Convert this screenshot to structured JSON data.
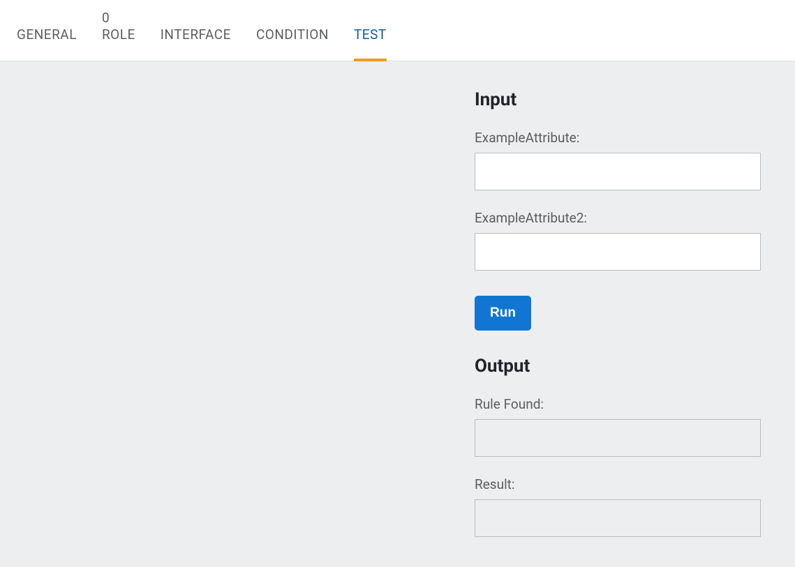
{
  "tabs": {
    "general": "GENERAL",
    "role_badge": "0",
    "role": "ROLE",
    "interface": "INTERFACE",
    "condition": "CONDITION",
    "test": "TEST"
  },
  "panel": {
    "input_heading": "Input",
    "field1_label": "ExampleAttribute:",
    "field1_value": "",
    "field2_label": "ExampleAttribute2:",
    "field2_value": "",
    "run_label": "Run",
    "output_heading": "Output",
    "rule_found_label": "Rule Found:",
    "rule_found_value": "",
    "result_label": "Result:",
    "result_value": ""
  }
}
